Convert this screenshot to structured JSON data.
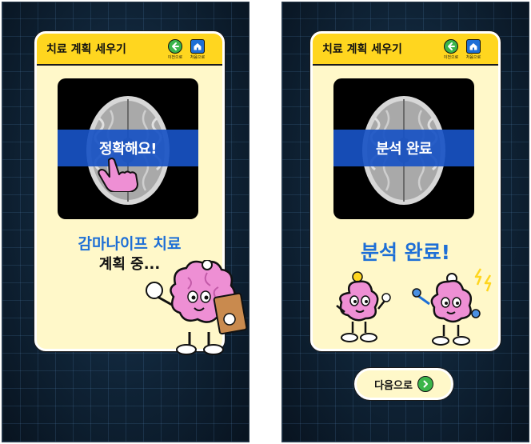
{
  "screens": [
    {
      "header": {
        "title": "치료 계획 세우기",
        "back_label": "이전으로",
        "home_label": "처음으로"
      },
      "scan_overlay_text": "정확해요!",
      "status_line1": "감마나이프 치료",
      "status_line2": "계획 중..."
    },
    {
      "header": {
        "title": "치료 계획 세우기",
        "back_label": "이전으로",
        "home_label": "처음으로"
      },
      "scan_overlay_text": "분석 완료",
      "status_line1": "분석 완료!",
      "next_button_label": "다음으로"
    }
  ],
  "icons": {
    "back": "arrow-left-icon",
    "home": "home-icon",
    "next": "chevron-right-icon"
  },
  "colors": {
    "header_bg": "#ffd61f",
    "card_bg": "#fff8c9",
    "accent_blue": "#1e6fd6",
    "scan_band": "#1853c4",
    "button_green": "#3bb54a",
    "brain_pink": "#ee8fd4"
  }
}
